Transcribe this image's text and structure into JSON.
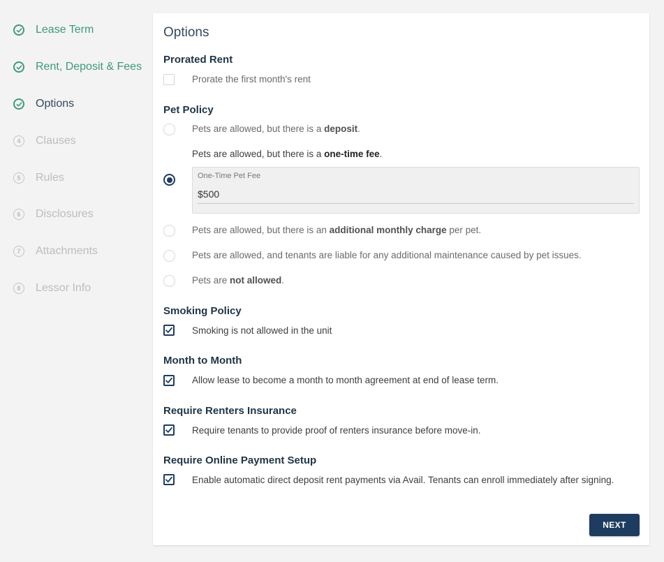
{
  "sidebar": {
    "steps": [
      {
        "label": "Lease Term",
        "state": "done"
      },
      {
        "label": "Rent, Deposit & Fees",
        "state": "done"
      },
      {
        "label": "Options",
        "state": "current"
      },
      {
        "label": "Clauses",
        "state": "todo",
        "number": "4"
      },
      {
        "label": "Rules",
        "state": "todo",
        "number": "5"
      },
      {
        "label": "Disclosures",
        "state": "todo",
        "number": "6"
      },
      {
        "label": "Attachments",
        "state": "todo",
        "number": "7"
      },
      {
        "label": "Lessor Info",
        "state": "todo",
        "number": "8"
      }
    ]
  },
  "main": {
    "title": "Options",
    "prorated": {
      "title": "Prorated Rent",
      "option": {
        "label": "Prorate the first month's rent",
        "checked": false
      }
    },
    "pet_policy": {
      "title": "Pet Policy",
      "options": [
        {
          "prefix": "Pets are allowed, but there is a ",
          "bold": "deposit",
          "suffix": ".",
          "selected": false
        },
        {
          "prefix": "Pets are allowed, but there is a ",
          "bold": "one-time fee",
          "suffix": ".",
          "selected": true
        },
        {
          "prefix": "Pets are allowed, but there is an ",
          "bold": "additional monthly charge",
          "suffix": " per pet.",
          "selected": false
        },
        {
          "prefix": "Pets are allowed, and tenants are liable for any additional maintenance caused by pet issues.",
          "bold": "",
          "suffix": "",
          "selected": false
        },
        {
          "prefix": "Pets are ",
          "bold": "not allowed",
          "suffix": ".",
          "selected": false
        }
      ],
      "fee_field": {
        "label": "One-Time Pet Fee",
        "value": "$500"
      }
    },
    "smoking": {
      "title": "Smoking Policy",
      "option": {
        "label": "Smoking is not allowed in the unit",
        "checked": true
      }
    },
    "month_to_month": {
      "title": "Month to Month",
      "option": {
        "label": "Allow lease to become a month to month agreement at end of lease term.",
        "checked": true
      }
    },
    "insurance": {
      "title": "Require Renters Insurance",
      "option": {
        "label": "Require tenants to provide proof of renters insurance before move-in.",
        "checked": true
      }
    },
    "payment": {
      "title": "Require Online Payment Setup",
      "option": {
        "label": "Enable automatic direct deposit rent payments via Avail. Tenants can enroll immediately after signing.",
        "checked": true
      }
    },
    "next_label": "NEXT"
  },
  "colors": {
    "done_green": "#3d9a7a",
    "navy": "#1e3c60",
    "muted": "#bdbdbd"
  }
}
